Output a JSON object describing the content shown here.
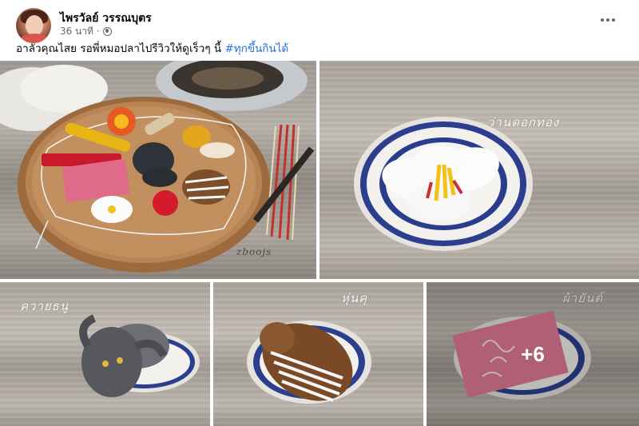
{
  "post": {
    "author_name": "ไพรวัลย์ วรรณบุตร",
    "time": "36 นาที ·",
    "caption_text": "อาลัวคุณไสย รอพี่หมอปลาไปรีวิวให้ดูเร็วๆ นี้ ",
    "caption_hashtag": "#ทุกขึ้นกินได้"
  },
  "photos": {
    "photo2_watermark": "ว่านดอกทอง",
    "photo3_watermark": "ควายธนู",
    "photo4_watermark": "หุ่นคุ",
    "photo5_watermark": "ผ้ายันต์",
    "more_count": "+6",
    "photo1_signature": "zboojs"
  },
  "icons": {
    "more": "more-options-icon",
    "privacy": "globe-icon"
  }
}
